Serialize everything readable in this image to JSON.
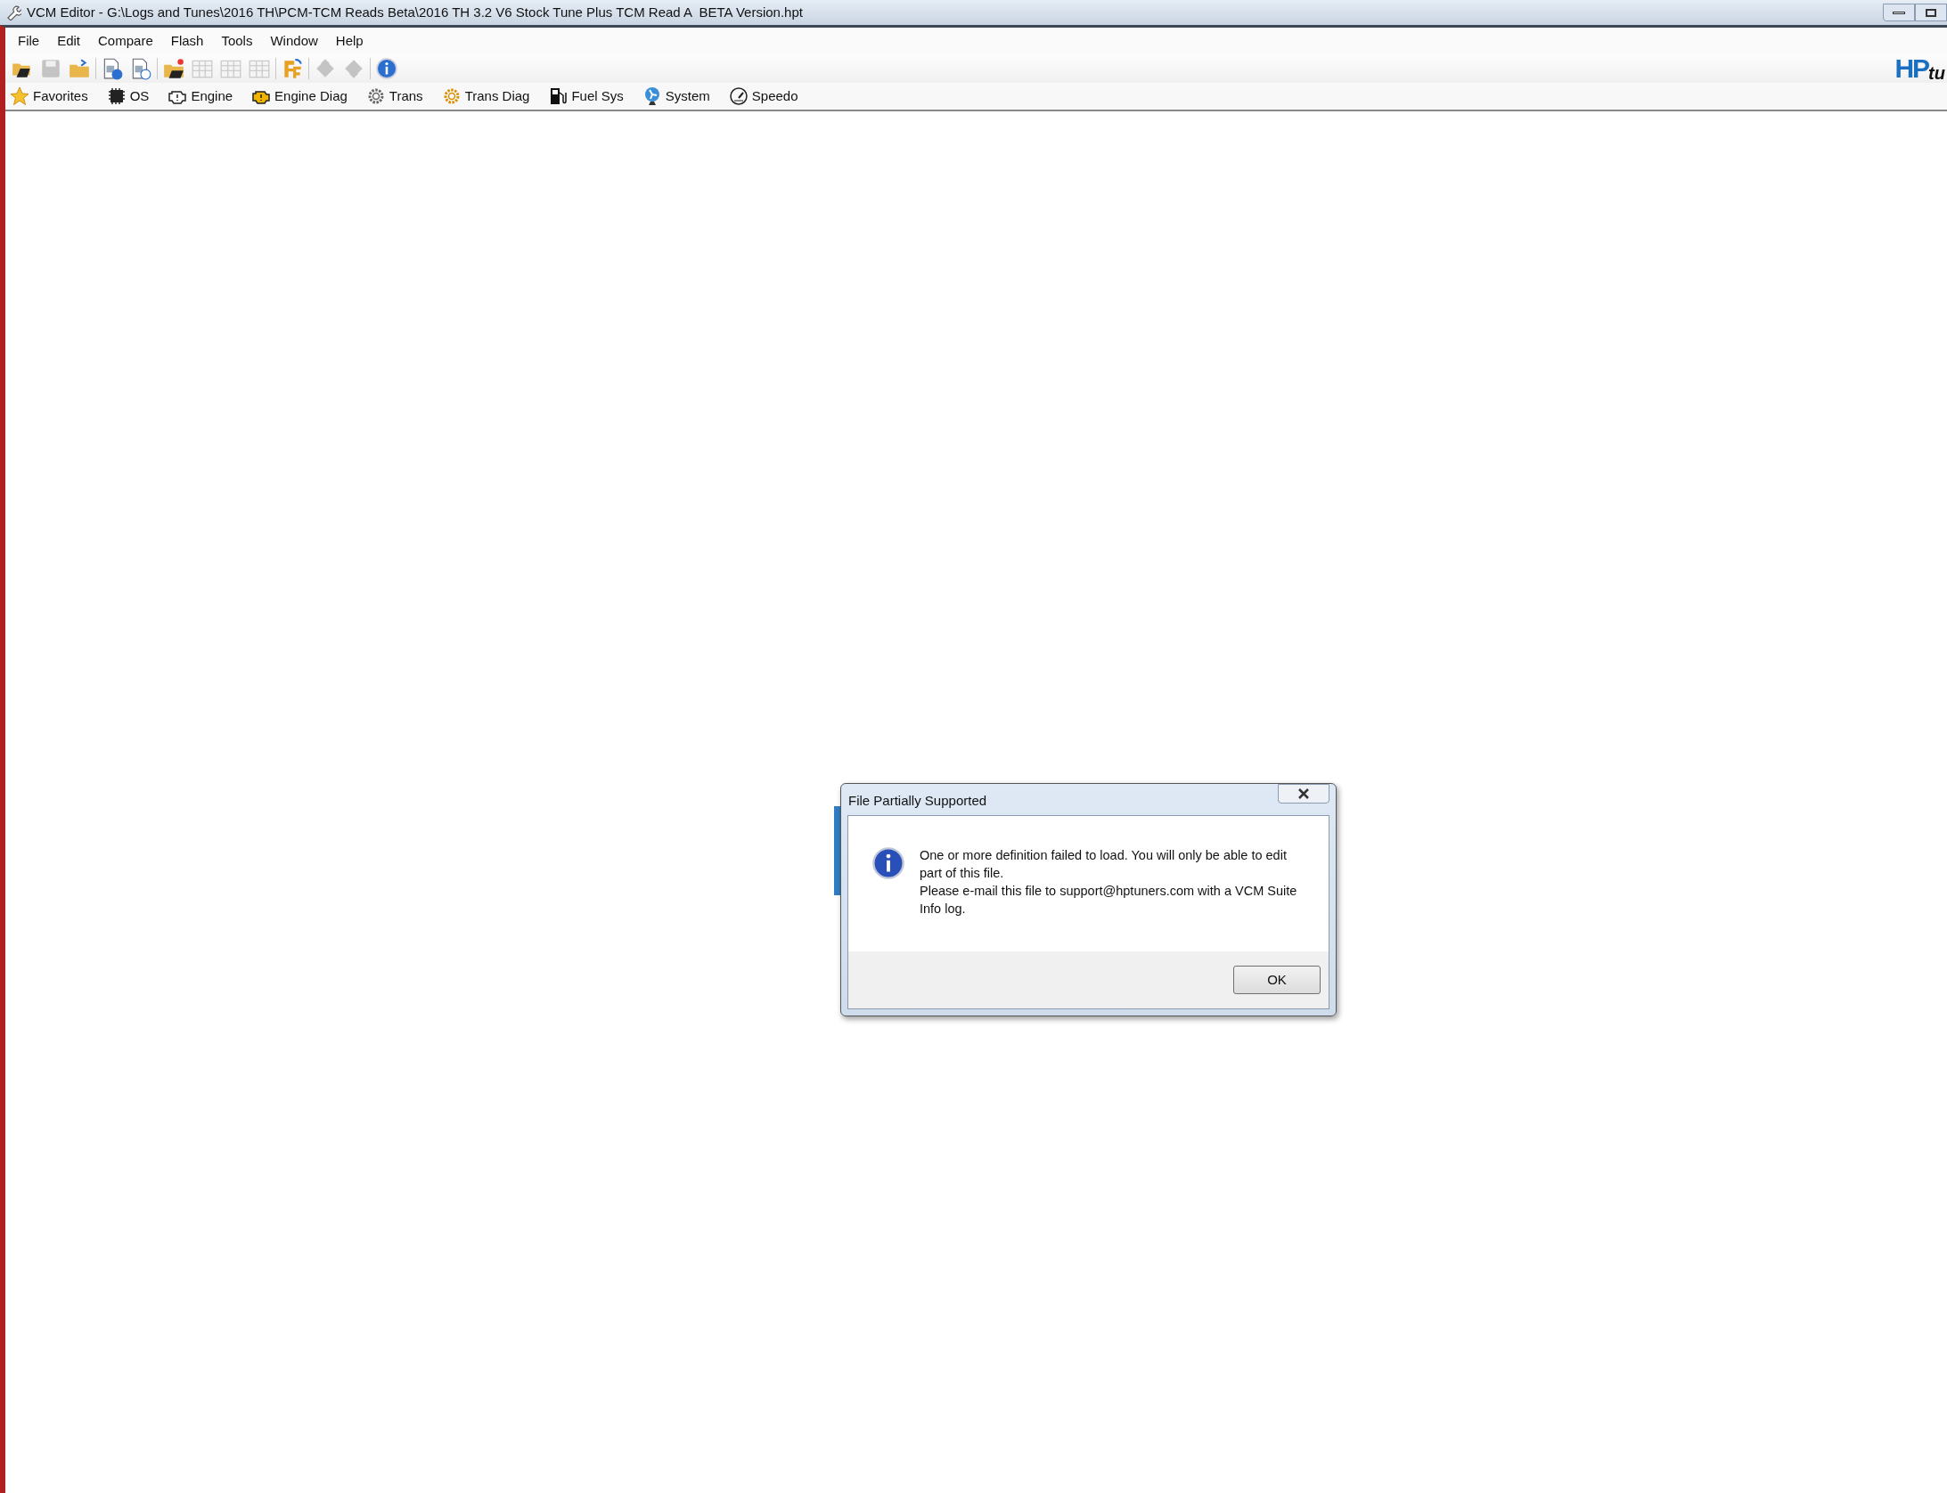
{
  "window": {
    "title": "VCM Editor - G:\\Logs and Tunes\\2016 TH\\PCM-TCM Reads Beta\\2016 TH 3.2 V6 Stock Tune Plus TCM Read A  BETA Version.hpt"
  },
  "menu": [
    "File",
    "Edit",
    "Compare",
    "Flash",
    "Tools",
    "Window",
    "Help"
  ],
  "toolbar": [
    {
      "kind": "open",
      "disabled": false
    },
    {
      "kind": "save",
      "disabled": true
    },
    {
      "kind": "folder",
      "disabled": false
    },
    {
      "kind": "sep"
    },
    {
      "kind": "doc-info",
      "disabled": false
    },
    {
      "kind": "doc-clock",
      "disabled": false
    },
    {
      "kind": "sep"
    },
    {
      "kind": "open-new",
      "disabled": false
    },
    {
      "kind": "table",
      "disabled": true
    },
    {
      "kind": "table",
      "disabled": true
    },
    {
      "kind": "table",
      "disabled": true
    },
    {
      "kind": "sep"
    },
    {
      "kind": "convert",
      "disabled": false
    },
    {
      "kind": "sep"
    },
    {
      "kind": "chip-up",
      "disabled": true
    },
    {
      "kind": "chip-down",
      "disabled": true
    },
    {
      "kind": "sep"
    },
    {
      "kind": "info",
      "disabled": false
    }
  ],
  "logo": {
    "main": "HP",
    "tail": "tu"
  },
  "shortcuts": [
    {
      "kind": "star",
      "label": "Favorites"
    },
    {
      "kind": "chip",
      "label": "OS"
    },
    {
      "kind": "engine",
      "label": "Engine"
    },
    {
      "kind": "engine-diag",
      "label": "Engine Diag"
    },
    {
      "kind": "gear",
      "label": "Trans"
    },
    {
      "kind": "gear-diag",
      "label": "Trans Diag"
    },
    {
      "kind": "fuel",
      "label": "Fuel Sys"
    },
    {
      "kind": "fan",
      "label": "System"
    },
    {
      "kind": "gauge",
      "label": "Speedo"
    }
  ],
  "dialog": {
    "title": "File Partially Supported",
    "lines": [
      "One or more definition failed to load. You will only be able to edit part of this file.",
      "Please e-mail this file to support@hptuners.com with a VCM Suite Info log."
    ],
    "button": "OK"
  }
}
